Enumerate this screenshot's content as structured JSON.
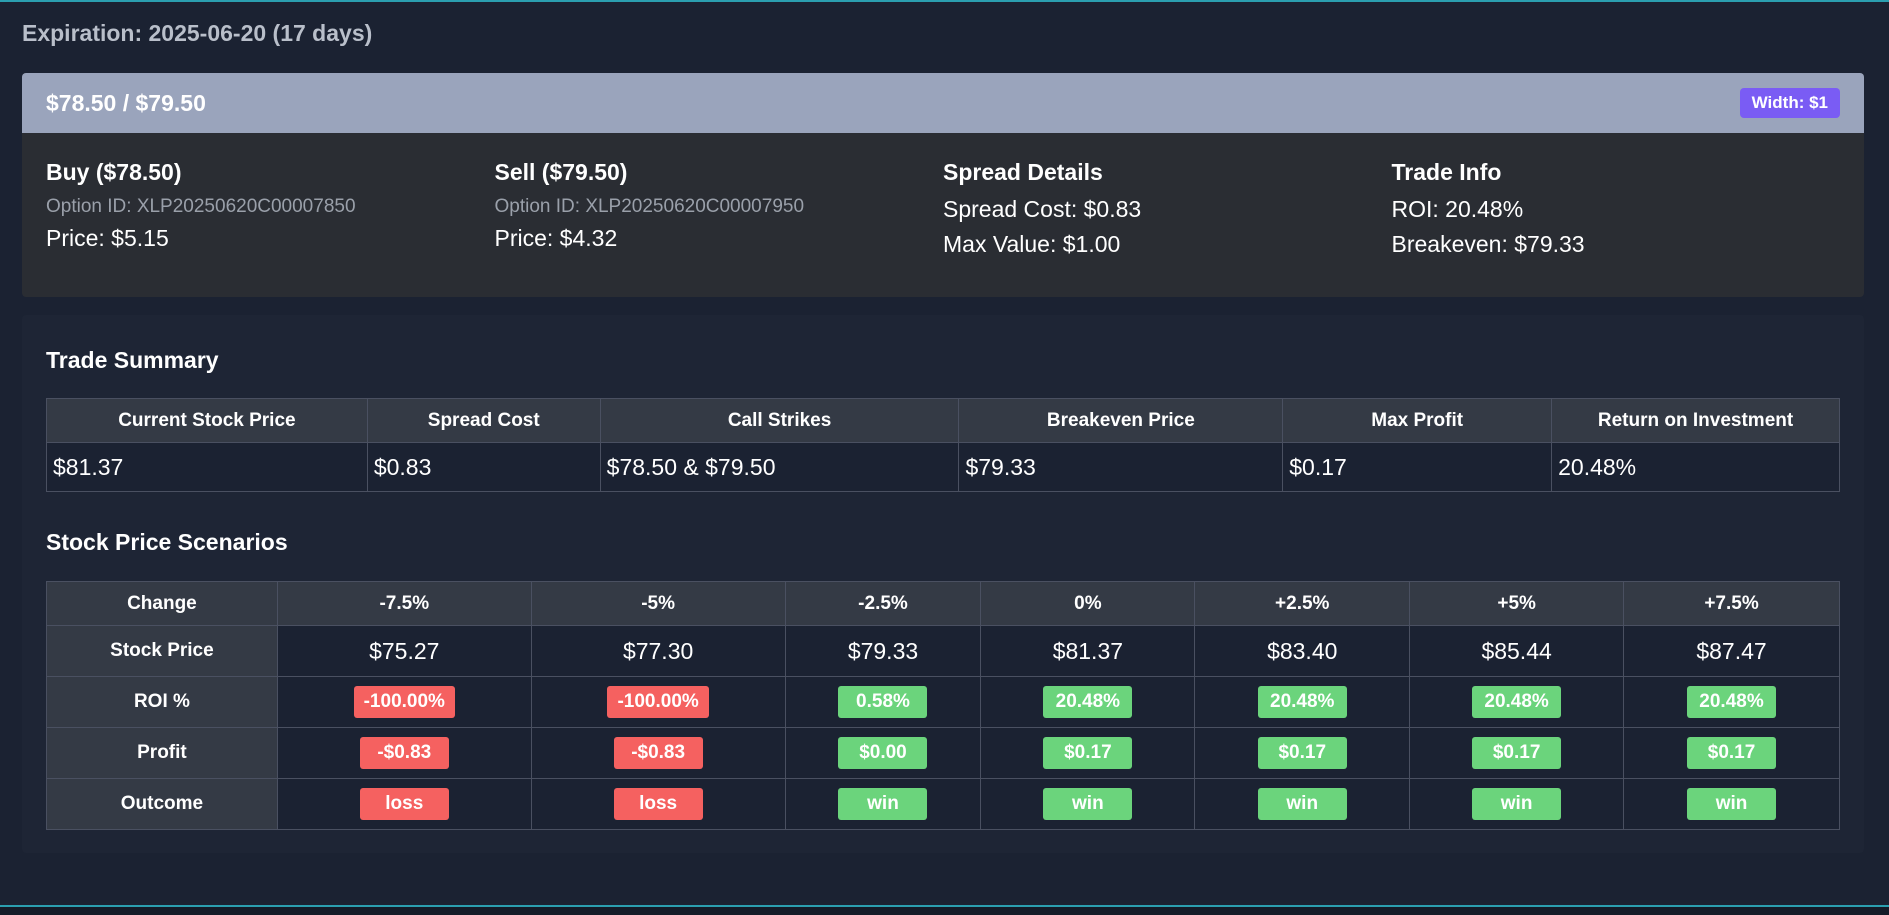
{
  "expiration": "Expiration: 2025-06-20 (17 days)",
  "spread": {
    "title": "$78.50 / $79.50",
    "width_badge": "Width: $1",
    "buy": {
      "heading": "Buy ($78.50)",
      "option_id": "Option ID: XLP20250620C00007850",
      "price": "Price: $5.15"
    },
    "sell": {
      "heading": "Sell ($79.50)",
      "option_id": "Option ID: XLP20250620C00007950",
      "price": "Price: $4.32"
    },
    "details": {
      "heading": "Spread Details",
      "cost": "Spread Cost: $0.83",
      "max_value": "Max Value: $1.00"
    },
    "trade_info": {
      "heading": "Trade Info",
      "roi": "ROI: 20.48%",
      "breakeven": "Breakeven: $79.33"
    }
  },
  "summary": {
    "title": "Trade Summary",
    "headers": [
      "Current Stock Price",
      "Spread Cost",
      "Call Strikes",
      "Breakeven Price",
      "Max Profit",
      "Return on Investment"
    ],
    "values": [
      "$81.37",
      "$0.83",
      "$78.50 & $79.50",
      "$79.33",
      "$0.17",
      "20.48%"
    ]
  },
  "scenarios": {
    "title": "Stock Price Scenarios",
    "row_labels": {
      "change": "Change",
      "stock_price": "Stock Price",
      "roi": "ROI %",
      "profit": "Profit",
      "outcome": "Outcome"
    },
    "changes": [
      "-7.5%",
      "-5%",
      "-2.5%",
      "0%",
      "+2.5%",
      "+5%",
      "+7.5%"
    ],
    "stock_prices": [
      "$75.27",
      "$77.30",
      "$79.33",
      "$81.37",
      "$83.40",
      "$85.44",
      "$87.47"
    ],
    "roi": [
      "-100.00%",
      "-100.00%",
      "0.58%",
      "20.48%",
      "20.48%",
      "20.48%",
      "20.48%"
    ],
    "profit": [
      "-$0.83",
      "-$0.83",
      "$0.00",
      "$0.17",
      "$0.17",
      "$0.17",
      "$0.17"
    ],
    "outcome": [
      "loss",
      "loss",
      "win",
      "win",
      "win",
      "win",
      "win"
    ]
  },
  "colors": {
    "background": "#1b2232",
    "card": "#2a2d33",
    "header": "#9aa4bc",
    "accent": "#7a5cf4",
    "loss": "#f56160",
    "win": "#6bd47c"
  }
}
